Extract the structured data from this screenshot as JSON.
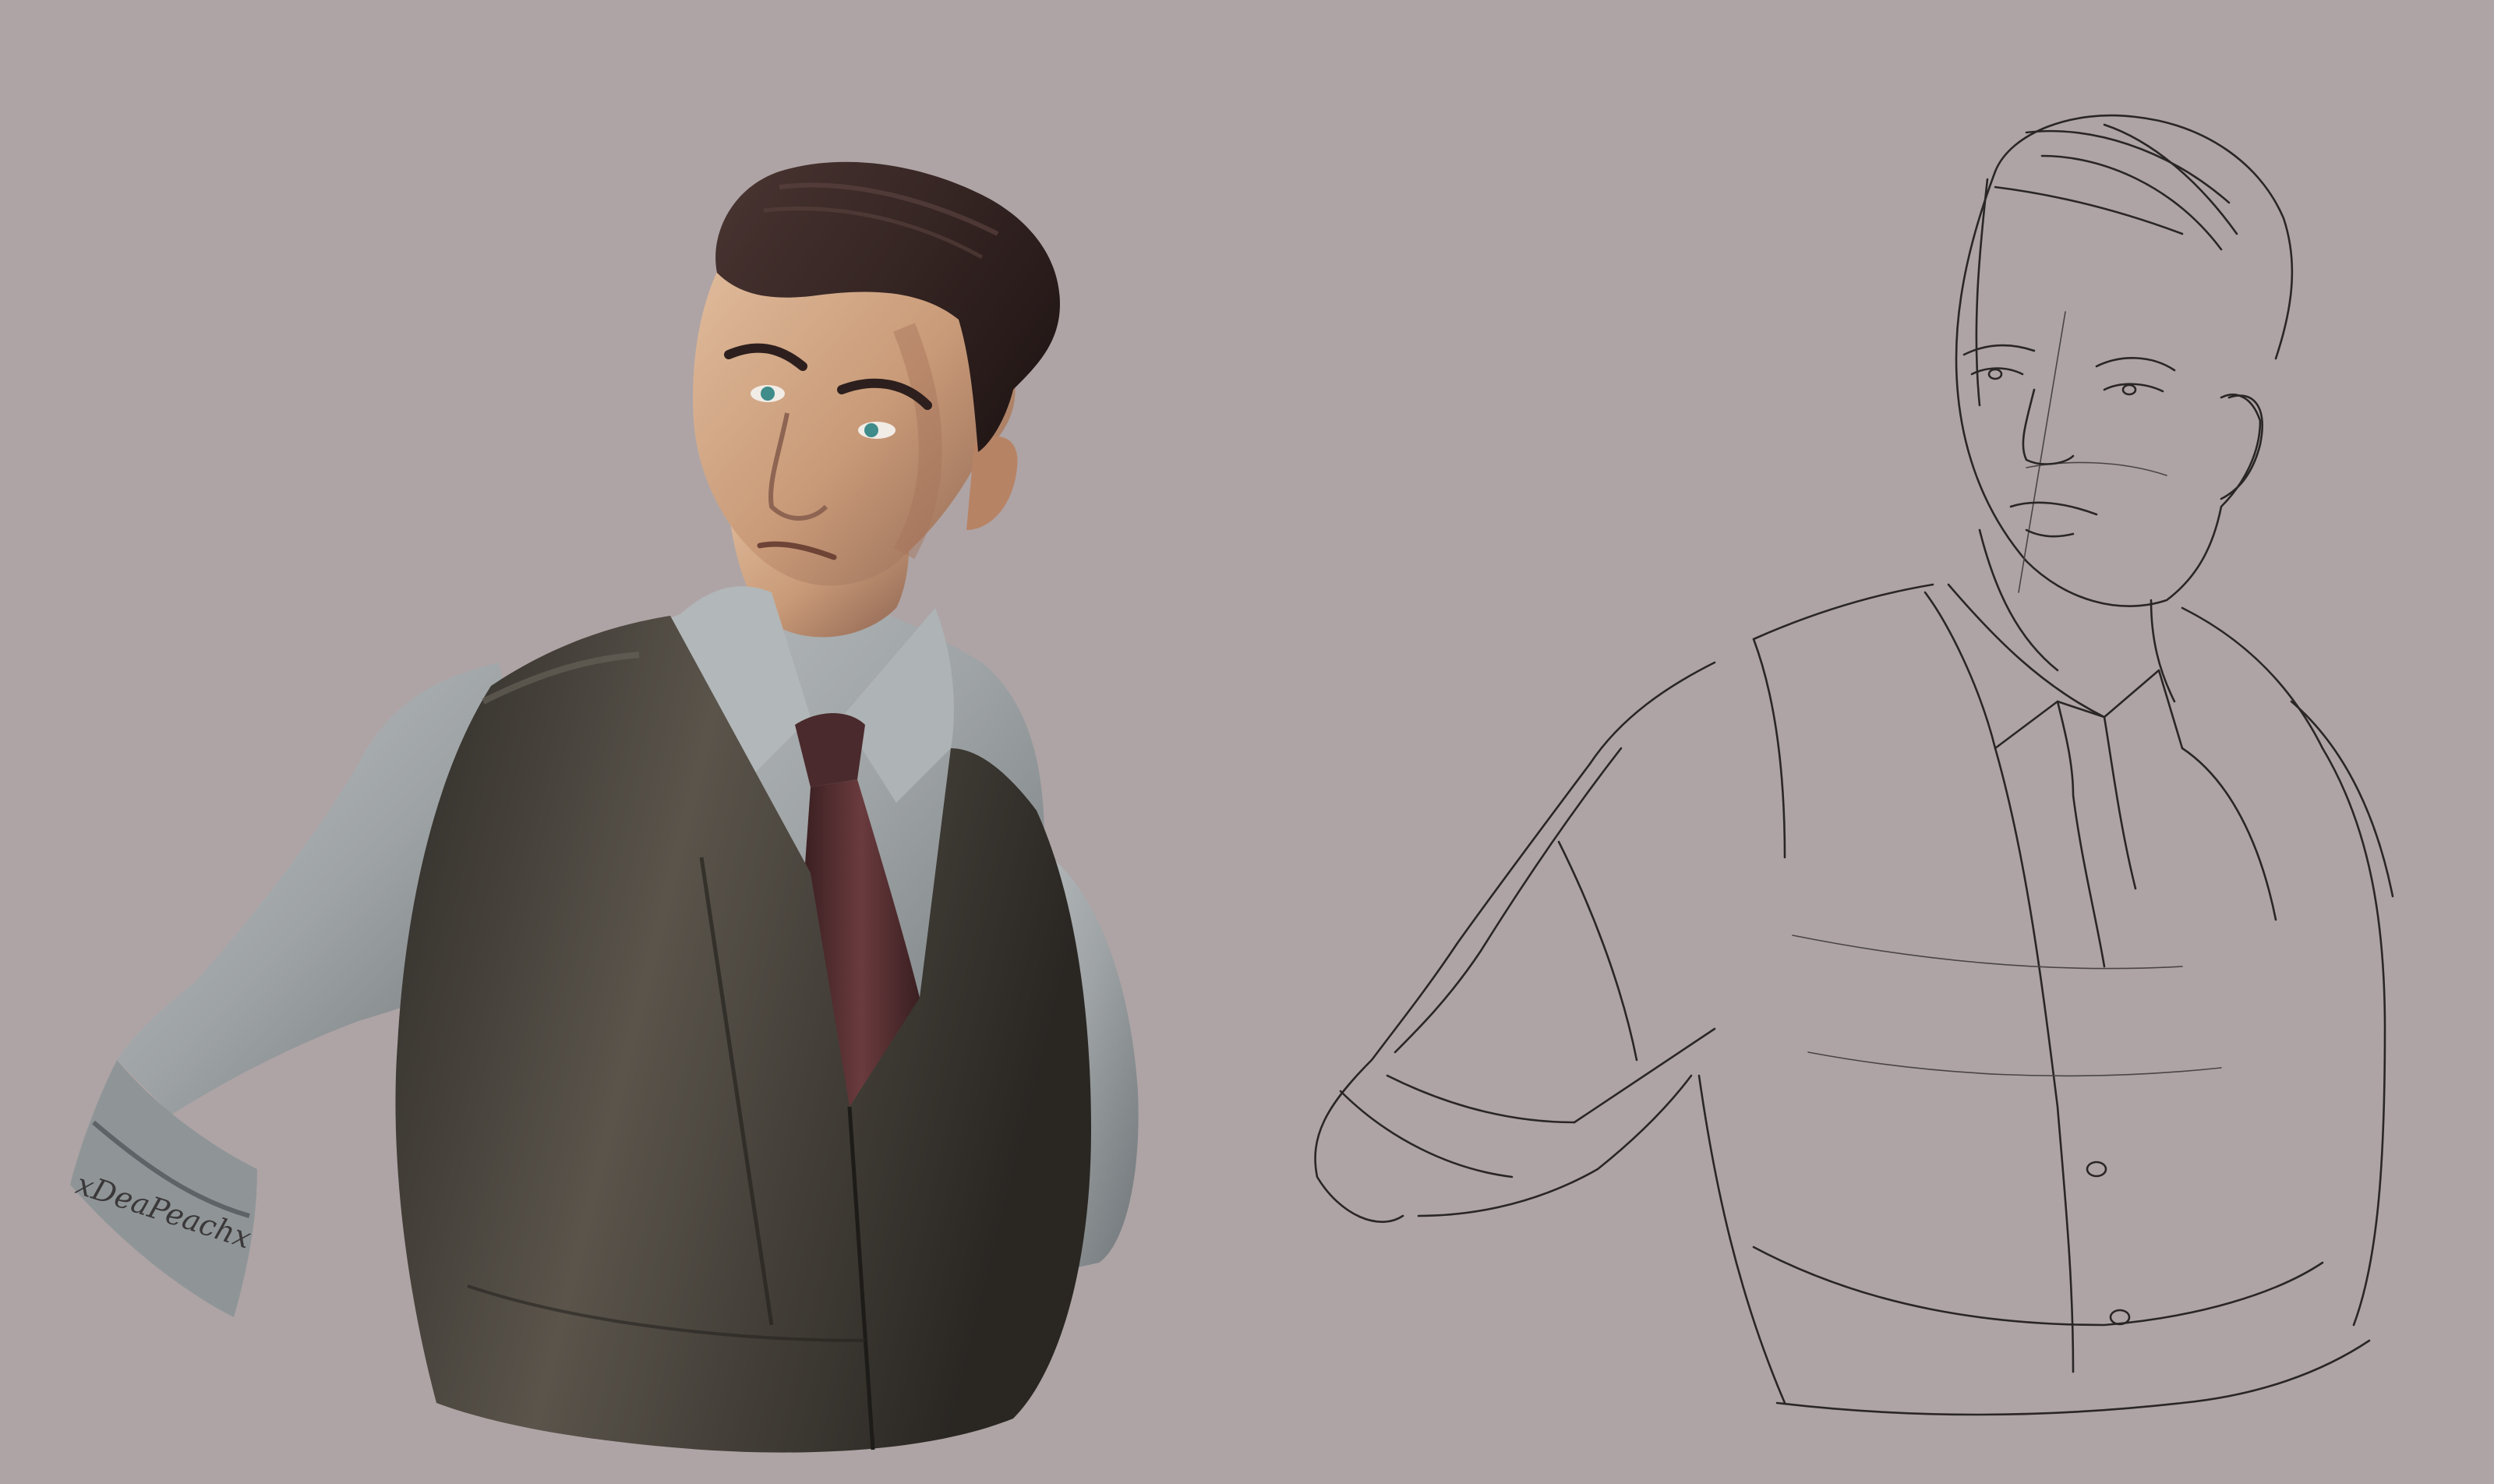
{
  "artwork": {
    "background_color": "#aea4a5",
    "painted_figure": {
      "hair_color": "#3a2826",
      "skin_color": "#c99a78",
      "skin_shadow": "#a6735a",
      "eye_color": "#3f8c8a",
      "shirt_color": "#9ea3a5",
      "shirt_shadow": "#6f7578",
      "vest_color": "#3f3b35",
      "vest_highlight": "#5a544b",
      "tie_color": "#4a2a2c",
      "tie_highlight": "#6a3b3e"
    },
    "sketch_figure": {
      "line_color": "#2a2627"
    },
    "signature_text": "xDeaPeachx"
  }
}
